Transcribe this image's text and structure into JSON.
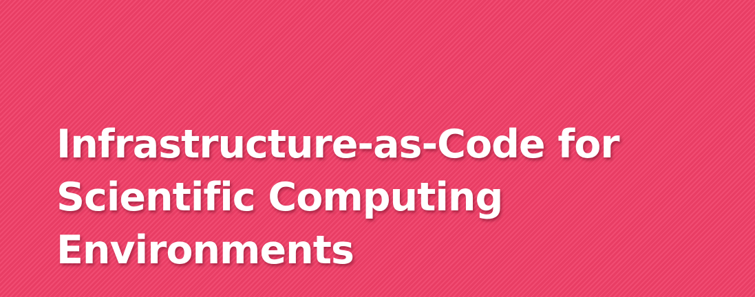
{
  "slide": {
    "background_color": "#f03f68",
    "title_color": "#ffffff",
    "title_lines": [
      "Infrastructure-as-Code for",
      "Scientific Computing",
      "Environments"
    ]
  }
}
